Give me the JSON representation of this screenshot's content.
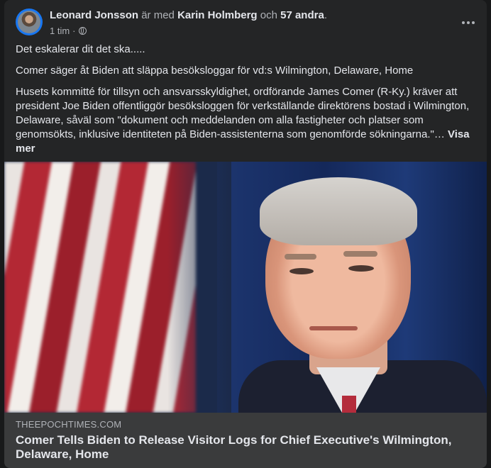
{
  "post": {
    "author": "Leonard Jonsson",
    "with_text": "är med",
    "tagged": "Karin Holmberg",
    "and_text": "och",
    "others": "57 andra",
    "period": ".",
    "time": "1 tim",
    "dot_sep": "·",
    "privacy_icon": "globe-icon",
    "more_icon": "more-options-icon",
    "paragraphs": [
      "Det eskalerar dit det ska.....",
      "Comer säger åt Biden att släppa besöksloggar för vd:s Wilmington, Delaware, Home",
      "Husets kommitté för tillsyn och ansvarsskyldighet, ordförande James Comer (R-Ky.) kräver att president Joe Biden offentliggör besöksloggen för verkställande direktörens bostad i Wilmington, Delaware, såväl som \"dokument och meddelanden om alla fastigheter och platser som genomsökts, inklusive identiteten på Biden-assistenterna som genomförde sökningarna.\"…"
    ],
    "see_more": "Visa mer"
  },
  "link_preview": {
    "domain": "THEEPOCHTIMES.COM",
    "title": "Comer Tells Biden to Release Visitor Logs for Chief Executive's Wilmington, Delaware, Home"
  },
  "colors": {
    "background": "#18191a",
    "card": "#242526",
    "link_box": "#3a3b3c",
    "primary_text": "#e4e6eb",
    "secondary_text": "#b0b3b8"
  }
}
